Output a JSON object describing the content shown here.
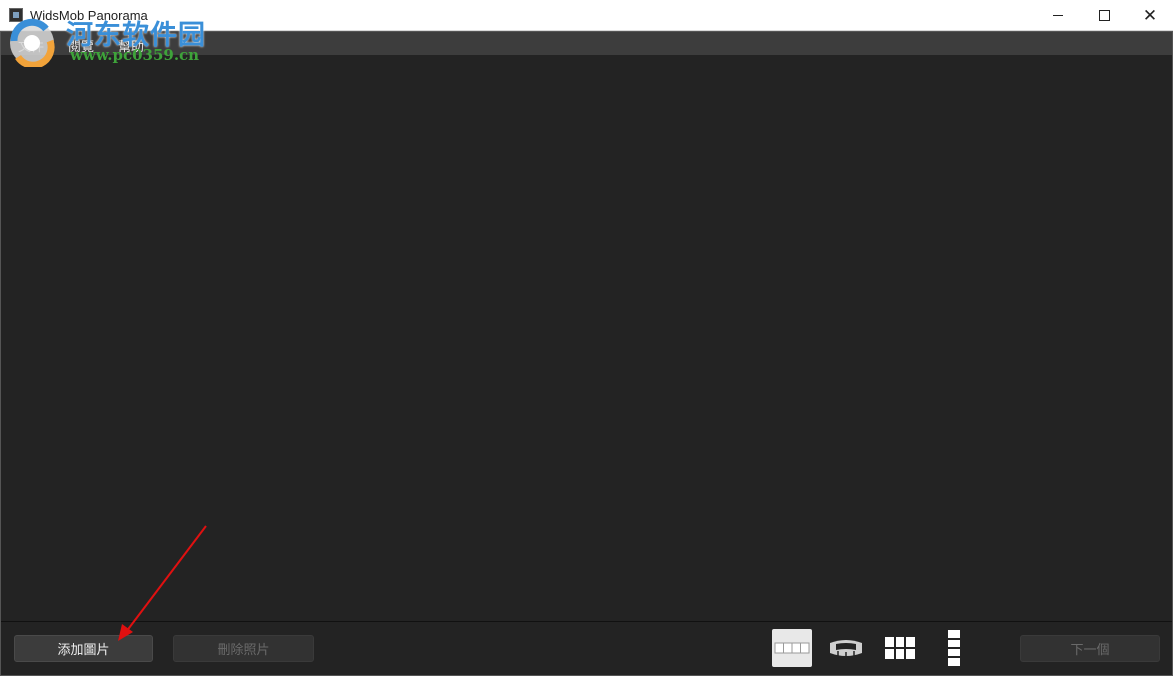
{
  "window": {
    "title": "WidsMob Panorama",
    "minimize_label": "minimize",
    "maximize_label": "maximize",
    "close_glyph": "✕"
  },
  "menu": {
    "items": [
      {
        "label": "文件"
      },
      {
        "label": "閱覽"
      },
      {
        "label": "幫助"
      }
    ]
  },
  "toolbar": {
    "add_label": "添加圖片",
    "delete_label": "刪除照片",
    "next_label": "下一個",
    "modes": [
      {
        "icon": "horizontal-panorama-icon",
        "selected": true
      },
      {
        "icon": "360-cylinder-icon",
        "selected": false
      },
      {
        "icon": "grid-tile-icon",
        "selected": false
      },
      {
        "icon": "vertical-panorama-icon",
        "selected": false
      }
    ]
  },
  "watermark": {
    "site_name": "河东软件园",
    "url": "www.pc0359.cn"
  },
  "colors": {
    "background": "#232323",
    "menubar": "#3d3d3d",
    "button": "#3c3c3c",
    "button_disabled": "#323232",
    "selected_mode": "#e8e8e8",
    "annotation_arrow": "#e01010",
    "watermark_blue": "#3a8fd8",
    "watermark_green": "#3ea33a"
  }
}
